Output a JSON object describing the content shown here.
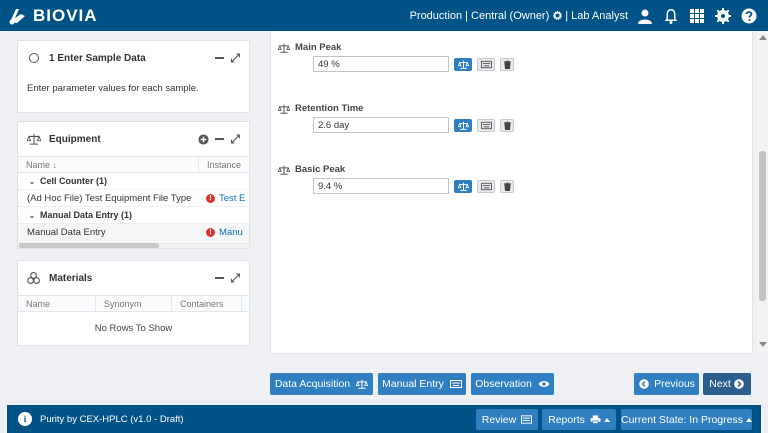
{
  "header": {
    "brand": "BIOVIA",
    "context": "Production",
    "owner": "Central (Owner)",
    "role": "Lab Analyst"
  },
  "sample_panel": {
    "title": "1 Enter Sample Data",
    "description": "Enter parameter values for each sample."
  },
  "equipment": {
    "title": "Equipment",
    "columns": [
      "Name ↓",
      "Instance"
    ],
    "rows": [
      {
        "type": "group",
        "label": "Cell Counter (1)"
      },
      {
        "type": "item",
        "name": "(Ad Hoc File) Test Equipment File Type",
        "instance": "Test E"
      },
      {
        "type": "group",
        "label": "Manual Data Entry (1)"
      },
      {
        "type": "item",
        "name": "Manual Data Entry",
        "instance": "Manu"
      }
    ]
  },
  "materials": {
    "title": "Materials",
    "columns": [
      "Name",
      "Synonym",
      "Containers"
    ],
    "empty_text": "No Rows To Show"
  },
  "fields": [
    {
      "label": "Main Peak",
      "value": "49 %"
    },
    {
      "label": "Retention Time",
      "value": "2.6 day"
    },
    {
      "label": "Basic Peak",
      "value": "9.4 %"
    }
  ],
  "actions": {
    "data_acquisition": "Data Acquisition",
    "manual_entry": "Manual Entry",
    "observation": "Observation",
    "previous": "Previous",
    "next": "Next"
  },
  "footer": {
    "title": "Purity by CEX-HPLC (v1.0 - Draft)",
    "review": "Review",
    "reports": "Reports",
    "state": "Current State: In Progress"
  },
  "colors": {
    "header_bg": "#005386",
    "button": "#2f7fc1",
    "error": "#dd3333"
  }
}
